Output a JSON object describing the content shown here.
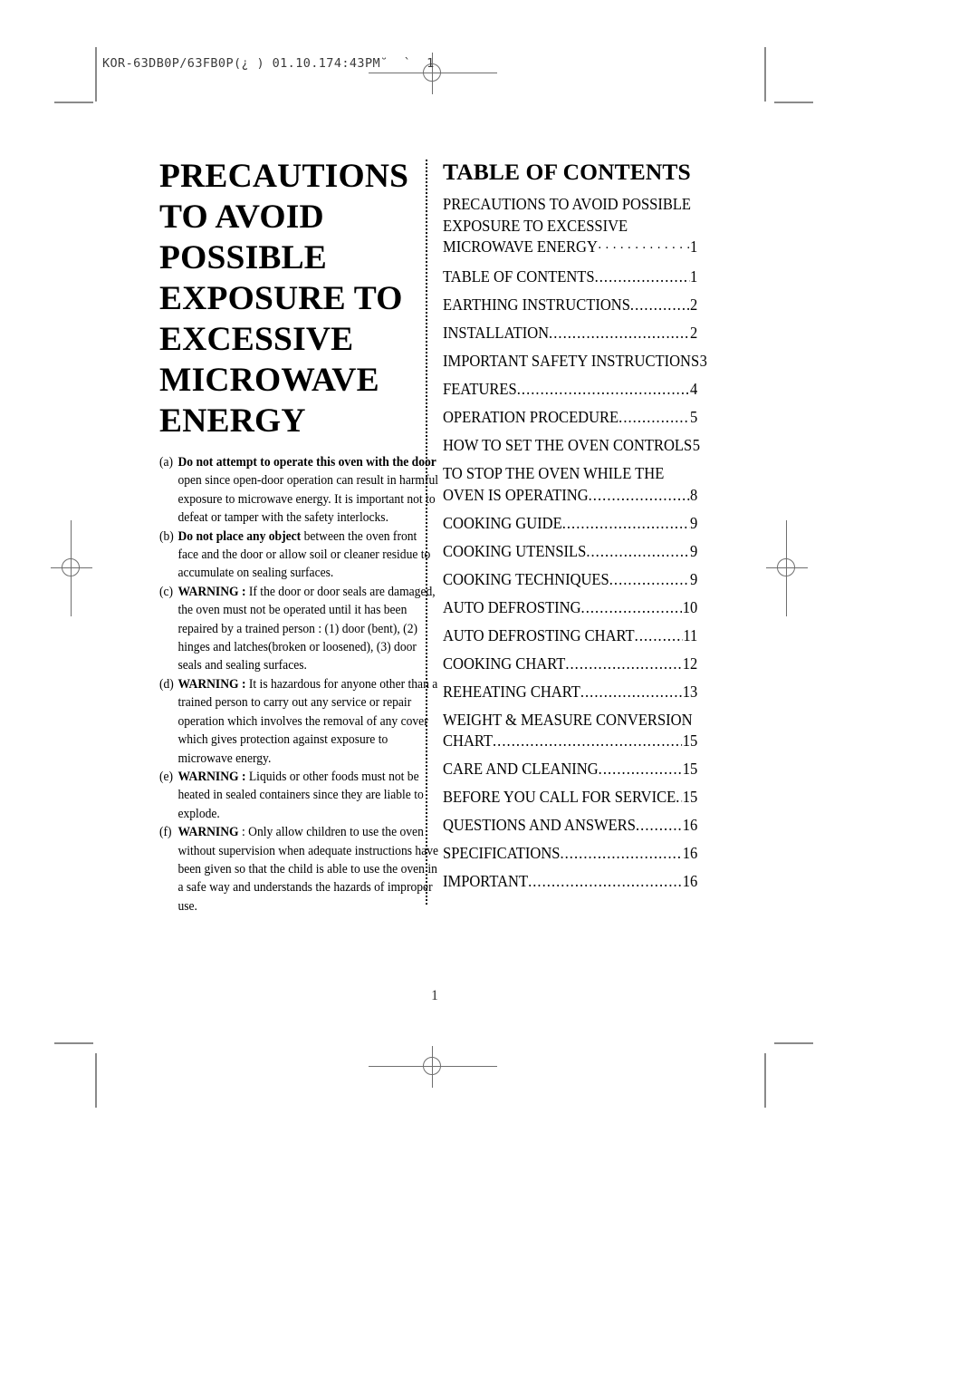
{
  "print_marks": {
    "header_slug": "KOR-63DB0P/63FB0P(¿ ) 01.10.174:43PM˘  `  1"
  },
  "document": {
    "title_lines": [
      "PRECAUTIONS",
      "TO AVOID",
      "POSSIBLE",
      "EXPOSURE TO",
      "EXCESSIVE",
      "MICROWAVE",
      "ENERGY"
    ],
    "precautions": [
      {
        "marker": "(a)",
        "bold": "Do not attempt to operate this oven with the door",
        "rest": " open since open-door operation can result in harmful exposure to microwave energy. It is important not to defeat or tamper with the safety interlocks."
      },
      {
        "marker": "(b)",
        "bold": "Do not place any object",
        "rest": " between the oven front face and the door or allow soil or cleaner residue to accumulate on sealing surfaces."
      },
      {
        "marker": "(c)",
        "bold": "WARNING :",
        "rest": " If the door or door seals are damaged, the oven must not be operated until it has been repaired by a trained person : (1) door (bent), (2) hinges and latches(broken or loosened), (3) door seals and sealing surfaces."
      },
      {
        "marker": "(d)",
        "bold": "WARNING :",
        "rest": " It is hazardous for anyone other than a trained person to carry out any service or repair operation which involves the removal of any cover which gives protection against exposure to microwave energy."
      },
      {
        "marker": "(e)",
        "bold": "WARNING :",
        "rest": " Liquids or other foods must not be heated in sealed containers since they are liable to explode."
      },
      {
        "marker": "(f)",
        "bold": "WARNING",
        "rest": " : Only allow children to use the oven without supervision when adequate instructions have been given so that the child is able to use the oven in a safe way and understands the hazards of improper use."
      }
    ],
    "toc_heading": "TABLE OF CONTENTS",
    "toc_entries": [
      {
        "prelines": [
          "PRECAUTIONS TO AVOID POSSIBLE",
          "EXPOSURE TO EXCESSIVE"
        ],
        "label": "MICROWAVE ENERGY",
        "page": "1",
        "dot_style": "sparse"
      },
      {
        "prelines": [],
        "label": "TABLE OF CONTENTS",
        "page": "1",
        "dot_style": "dense"
      },
      {
        "prelines": [],
        "label": "EARTHING INSTRUCTIONS",
        "page": "2",
        "dot_style": "dense"
      },
      {
        "prelines": [],
        "label": "INSTALLATION",
        "page": "2",
        "dot_style": "dense"
      },
      {
        "prelines": [],
        "label": "IMPORTANT SAFETY INSTRUCTIONS",
        "page": "3",
        "dot_style": "dense"
      },
      {
        "prelines": [],
        "label": "FEATURES",
        "page": "4",
        "dot_style": "dense"
      },
      {
        "prelines": [],
        "label": "OPERATION PROCEDURE",
        "page": "5",
        "dot_style": "dense"
      },
      {
        "prelines": [],
        "label": "HOW TO SET THE OVEN CONTROLS",
        "page": "5",
        "dot_style": "dense"
      },
      {
        "prelines": [
          "TO STOP THE OVEN WHILE THE"
        ],
        "label": "OVEN IS OPERATING",
        "page": "8",
        "dot_style": "dense"
      },
      {
        "prelines": [],
        "label": "COOKING GUIDE",
        "page": "9",
        "dot_style": "dense"
      },
      {
        "prelines": [],
        "label": "COOKING UTENSILS",
        "page": "9",
        "dot_style": "dense"
      },
      {
        "prelines": [],
        "label": "COOKING TECHNIQUES",
        "page": "9",
        "dot_style": "dense"
      },
      {
        "prelines": [],
        "label": "AUTO DEFROSTING",
        "page": "10",
        "dot_style": "dense"
      },
      {
        "prelines": [],
        "label": "AUTO DEFROSTING CHART",
        "page": "11",
        "dot_style": "dense"
      },
      {
        "prelines": [],
        "label": "COOKING CHART",
        "page": "12",
        "dot_style": "dense"
      },
      {
        "prelines": [],
        "label": "REHEATING CHART",
        "page": "13",
        "dot_style": "dense"
      },
      {
        "prelines": [
          "WEIGHT & MEASURE CONVERSION"
        ],
        "label": "CHART",
        "page": "15",
        "dot_style": "dense"
      },
      {
        "prelines": [],
        "label": "CARE AND CLEANING",
        "page": "15",
        "dot_style": "dense"
      },
      {
        "prelines": [],
        "label": "BEFORE YOU CALL FOR SERVICE",
        "page": "15",
        "dot_style": "dense"
      },
      {
        "prelines": [],
        "label": "QUESTIONS AND ANSWERS",
        "page": "16",
        "dot_style": "dense"
      },
      {
        "prelines": [],
        "label": "SPECIFICATIONS",
        "page": "16",
        "dot_style": "dense"
      },
      {
        "prelines": [],
        "label": "IMPORTANT",
        "page": "16",
        "dot_style": "dense"
      }
    ],
    "folio": "1"
  }
}
